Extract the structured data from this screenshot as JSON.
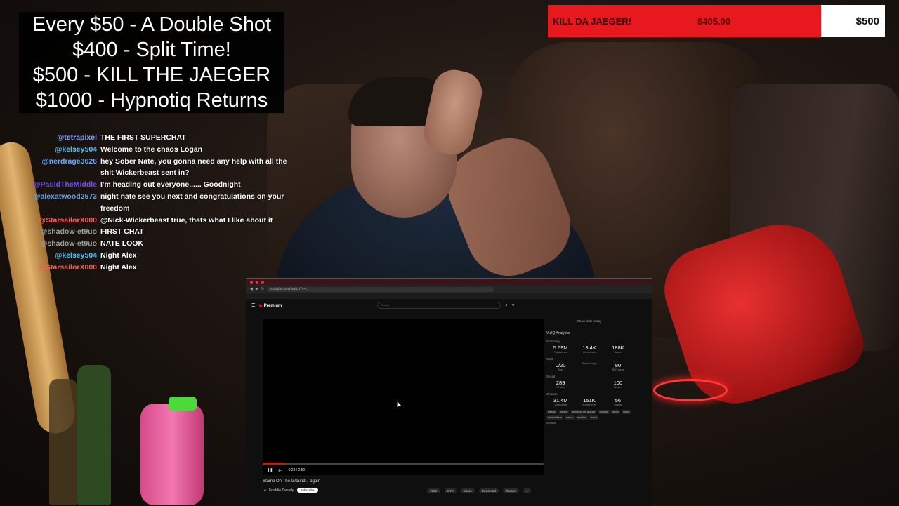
{
  "goals": {
    "lines": [
      "Every $50 - A Double Shot",
      "$400 - Split Time!",
      "$500 - KILL THE JAEGER",
      "$1000 - Hypnotiq Returns"
    ]
  },
  "donation_bar": {
    "label": "KILL DA JAEGER!",
    "current": "$405.00",
    "goal": "$500",
    "progress": 0.81,
    "fill_color": "#e8181f"
  },
  "chat": [
    {
      "user": "@tetrapixel",
      "user_color": "#8fa6ff",
      "text": "THE FIRST SUPERCHAT"
    },
    {
      "user": "@kelsey504",
      "user_color": "#4fc3ff",
      "text": "Welcome to the chaos Logan"
    },
    {
      "user": "@nerdrage3626",
      "user_color": "#6aa6ff",
      "text": "hey Sober Nate, you gonna need any help with all the shit Wickerbeast sent in?"
    },
    {
      "user": "@PauldTheMiddle",
      "user_color": "#6b4cff",
      "text": "I'm heading out everyone...... Goodnight"
    },
    {
      "user": "@alexatwood2573",
      "user_color": "#6aa2d8",
      "text": "night nate see you next and congratulations on your freedom"
    },
    {
      "user": "@StarsailorX000",
      "user_color": "#ff5a5a",
      "text": "@Nick-Wickerbeast true, thats what I like about it"
    },
    {
      "user": "@shadow-et9uo",
      "user_color": "#9aa09a",
      "text": "FIRST CHAT"
    },
    {
      "user": "@shadow-et9uo",
      "user_color": "#9aa09a",
      "text": "NATE LOOK"
    },
    {
      "user": "@kelsey504",
      "user_color": "#4fc3ff",
      "text": "Night Alex"
    },
    {
      "user": "@StarsailorX000",
      "user_color": "#ff5a5a",
      "text": "Night Alex"
    }
  ],
  "browser": {
    "url": "youtube.com/watch?v=...",
    "brand": "Premium",
    "search_placeholder": "Search",
    "video_title": "Stamp On The Ground... again",
    "channel_name": "Freddie Tweedy",
    "subscribe_label": "Subscribe",
    "time": "0:28 / 2:50",
    "actions": [
      "196K",
      "2.7K",
      "Share",
      "Download",
      "Thanks",
      "..."
    ],
    "panel": {
      "header": "Show chat replay",
      "tool": "VidIQ Analytics",
      "summary_label": "Summary",
      "summary": [
        {
          "value": "5.69M",
          "label": "Total views"
        },
        {
          "value": "13.4K",
          "label": "Comments"
        },
        {
          "value": "188K",
          "label": "Likes"
        }
      ],
      "seo_label": "SEO",
      "seo": [
        {
          "value": "0/20",
          "label": "Tags"
        },
        {
          "value": "",
          "label": "Ranked tags"
        },
        {
          "value": "80",
          "label": "SEO score"
        }
      ],
      "social_label": "Social",
      "social": [
        {
          "value": "289",
          "label": "FB likes"
        },
        {
          "value": "100",
          "label": "Shares"
        }
      ],
      "channel_label": "Channel",
      "channel": [
        {
          "value": "31.4M",
          "label": "Total views"
        },
        {
          "value": "151K",
          "label": "Subscribers"
        },
        {
          "value": "56",
          "label": "Videos"
        }
      ],
      "tags": [
        "freddie",
        "tweedy",
        "stamp on the ground",
        "comedy",
        "funny",
        "dance",
        "italobrothers",
        "meme",
        "reaction",
        "shorts"
      ],
      "shorts_label": "Shorts"
    }
  }
}
